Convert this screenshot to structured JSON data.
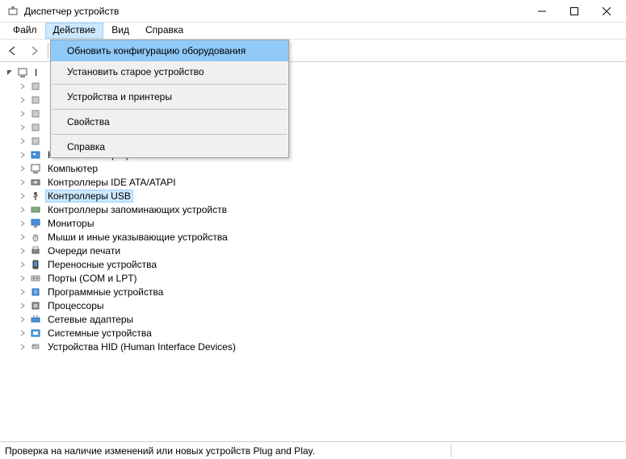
{
  "window": {
    "title": "Диспетчер устройств"
  },
  "menu": {
    "file": "Файл",
    "action": "Действие",
    "view": "Вид",
    "help": "Справка"
  },
  "dropdown": {
    "refresh": "Обновить конфигурацию оборудования",
    "add_legacy": "Установить старое устройство",
    "devices_printers": "Устройства и принтеры",
    "properties": "Свойства",
    "help": "Справка"
  },
  "tree": {
    "root": "I",
    "items": [
      {
        "label": ""
      },
      {
        "label": ""
      },
      {
        "label": ""
      },
      {
        "label": ""
      },
      {
        "label": ""
      },
      {
        "label": "Компоненты программного обеспечения",
        "icon": "software"
      },
      {
        "label": "Компьютер",
        "icon": "computer"
      },
      {
        "label": "Контроллеры IDE ATA/ATAPI",
        "icon": "ide"
      },
      {
        "label": "Контроллеры USB",
        "icon": "usb",
        "selected": true
      },
      {
        "label": "Контроллеры запоминающих устройств",
        "icon": "storage"
      },
      {
        "label": "Мониторы",
        "icon": "monitor"
      },
      {
        "label": "Мыши и иные указывающие устройства",
        "icon": "mouse"
      },
      {
        "label": "Очереди печати",
        "icon": "printer"
      },
      {
        "label": "Переносные устройства",
        "icon": "portable"
      },
      {
        "label": "Порты (COM и LPT)",
        "icon": "port"
      },
      {
        "label": "Программные устройства",
        "icon": "softdev"
      },
      {
        "label": "Процессоры",
        "icon": "cpu"
      },
      {
        "label": "Сетевые адаптеры",
        "icon": "network"
      },
      {
        "label": "Системные устройства",
        "icon": "system"
      },
      {
        "label": "Устройства HID (Human Interface Devices)",
        "icon": "hid"
      }
    ]
  },
  "statusbar": {
    "text": "Проверка на наличие изменений или новых устройств Plug and Play."
  }
}
